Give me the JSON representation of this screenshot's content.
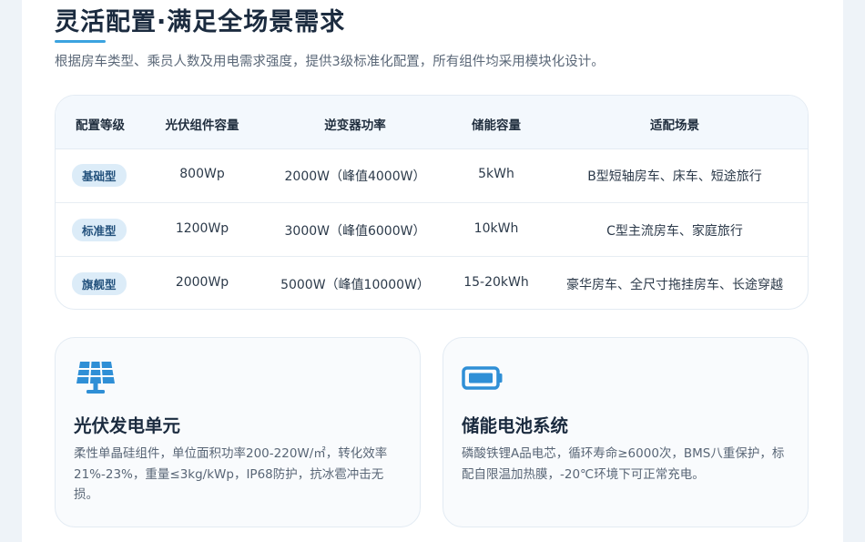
{
  "header": {
    "title": "灵活配置·满足全场景需求",
    "subtitle": "根据房车类型、乘员人数及用电需求强度，提供3级标准化配置，所有组件均采用模块化设计。"
  },
  "table": {
    "columns": [
      "配置等级",
      "光伏组件容量",
      "逆变器功率",
      "储能容量",
      "适配场景"
    ],
    "rows": [
      {
        "level": "基础型",
        "pv": "800Wp",
        "inverter": "2000W（峰值4000W）",
        "storage": "5kWh",
        "scene": "B型短轴房车、床车、短途旅行"
      },
      {
        "level": "标准型",
        "pv": "1200Wp",
        "inverter": "3000W（峰值6000W）",
        "storage": "10kWh",
        "scene": "C型主流房车、家庭旅行"
      },
      {
        "level": "旗舰型",
        "pv": "2000Wp",
        "inverter": "5000W（峰值10000W）",
        "storage": "15-20kWh",
        "scene": "豪华房车、全尺寸拖挂房车、长途穿越"
      }
    ]
  },
  "cards": [
    {
      "icon": "solar-panel-icon",
      "title": "光伏发电单元",
      "desc": "柔性单晶硅组件，单位面积功率200-220W/㎡，转化效率21%-23%，重量≤3kg/kWp，IP68防护，抗冰雹冲击无损。"
    },
    {
      "icon": "battery-icon",
      "title": "储能电池系统",
      "desc": "磷酸铁锂A品电芯，循环寿命≥6000次，BMS八重保护，标配自限温加热膜，-20℃环境下可正常充电。"
    }
  ],
  "colors": {
    "accent": "#3ba3e0",
    "badge_bg": "#dcecf8",
    "badge_text": "#24527d"
  }
}
